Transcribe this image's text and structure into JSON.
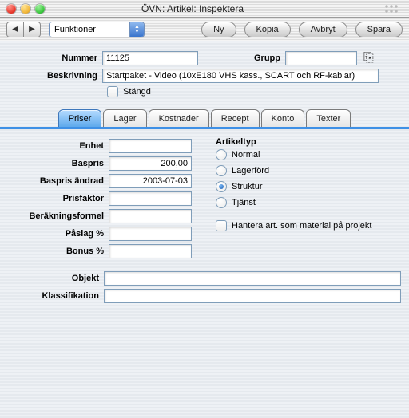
{
  "window": {
    "title": "ÖVN: Artikel: Inspektera"
  },
  "toolbar": {
    "funktioner": "Funktioner",
    "ny": "Ny",
    "kopia": "Kopia",
    "avbryt": "Avbryt",
    "spara": "Spara"
  },
  "form": {
    "nummer_label": "Nummer",
    "nummer_value": "11125",
    "grupp_label": "Grupp",
    "grupp_value": "",
    "beskrivning_label": "Beskrivning",
    "beskrivning_value": "Startpaket - Video (10xE180 VHS kass., SCART och RF-kablar)",
    "stangd_label": "Stängd"
  },
  "tabs": {
    "priser": "Priser",
    "lager": "Lager",
    "kostnader": "Kostnader",
    "recept": "Recept",
    "konto": "Konto",
    "texter": "Texter"
  },
  "priser": {
    "enhet_label": "Enhet",
    "enhet": "",
    "baspris_label": "Baspris",
    "baspris": "200,00",
    "baspris_andrad_label": "Baspris ändrad",
    "baspris_andrad": "2003-07-03",
    "prisfaktor_label": "Prisfaktor",
    "prisfaktor": "",
    "berakningsformel_label": "Beräkningsformel",
    "berakningsformel": "",
    "paslag_label": "Påslag %",
    "paslag": "",
    "bonus_label": "Bonus %",
    "bonus": "",
    "objekt_label": "Objekt",
    "objekt": "",
    "klass_label": "Klassifikation",
    "klass": ""
  },
  "artikeltyp": {
    "heading": "Artikeltyp",
    "normal": "Normal",
    "lagerford": "Lagerförd",
    "struktur": "Struktur",
    "tjanst": "Tjänst",
    "selected": "struktur"
  },
  "material": {
    "label": "Hantera art. som material på projekt"
  }
}
